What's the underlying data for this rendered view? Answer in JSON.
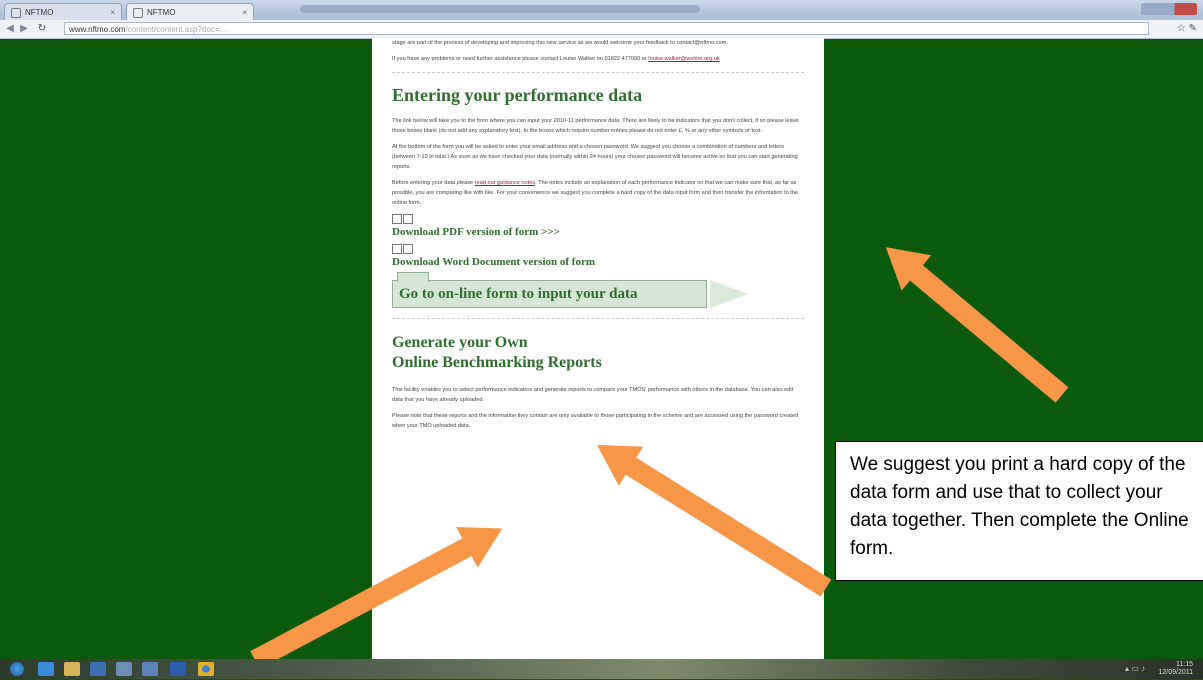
{
  "browser": {
    "tabs": [
      {
        "label": "NFTMO"
      },
      {
        "label": "NFTMO"
      }
    ],
    "url_host": "www.nftmo.com",
    "url_path": "/content/content.asp?doc=..."
  },
  "page": {
    "intro_paragraph_1": "stage are part of the process of developing and improving this new service as we would welcome your feedback to contact@nftmo.com.",
    "intro_paragraph_2": "If you have any problems or need further assistance please contact Louise Walker on 01822 477000 or",
    "intro_link": "louise.walker@wshire.org.uk",
    "heading_entering": "Entering your performance data",
    "para_entering_1": "The link below will take you to the form where you can input your 2010-11 performance data. There are likely to be indicators that you don't collect, if so please leave those boxes blank (do not add any explanatory text). In the boxes which require number entries please do not enter £, % or any other symbols or text.",
    "para_entering_2": "At the bottom of the form you will be asked to enter your email address and a chosen password. We suggest you choose a combination of numbers and letters (between 7-10 in total.) As soon as we have checked your data (normally within 24 hours) your chosen password will become active so that you can start generating reports.",
    "para_entering_3_before": "Before entering your data please",
    "para_entering_3_link": "read our guidance notes",
    "para_entering_3_after": ". The notes include an explanation of each performance indicator so that we can make sure that, as far as possible, you are comparing like with like. For your convenience we suggest you complete a hard copy of the data input form and then transfer the information to the online form.",
    "download_pdf": "Download PDF version of form >>>",
    "download_word": "Download Word Document version of form",
    "go_online_button": "Go to on-line form to input your data",
    "heading_generate_line1": "Generate your Own",
    "heading_generate_line2": "Online Benchmarking Reports",
    "para_generate_1": "This facility enables you to select performance indicators and generate reports to compare your TMOS' performance with others in the database. You can also edit data that you have already uploaded.",
    "para_generate_2": "Please note that these reports and the information they contain are only available to those participating in the scheme and are accessed using the password created when your TMO uploaded data."
  },
  "callout": {
    "text": "We suggest you print a hard copy of the data form and use that to collect your data together. Then complete the Online form."
  },
  "taskbar": {
    "clock_time": "11:15",
    "clock_date": "12/09/2011"
  },
  "colors": {
    "background": "#0b5a0b",
    "heading_green": "#2f6e2f",
    "arrow_orange": "#f79646",
    "link_red": "#a21b3b"
  }
}
